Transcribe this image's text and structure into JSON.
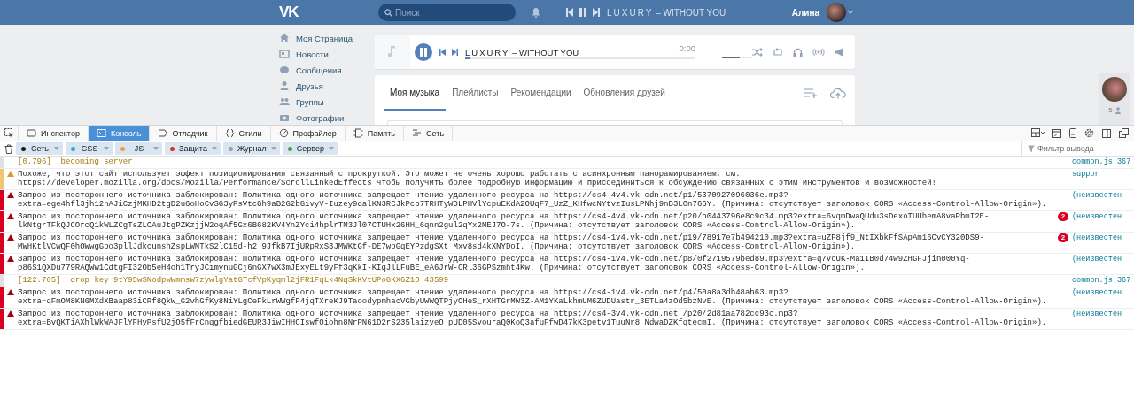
{
  "header": {
    "logo": "VK",
    "search": {
      "placeholder": "Поиск"
    },
    "now_playing": {
      "playing": true,
      "artist": "LUXURY",
      "title": "– WITHOUT YOU"
    },
    "user": {
      "name": "Алина"
    }
  },
  "sidebar": {
    "items": [
      {
        "label": "Моя Страница"
      },
      {
        "label": "Новости"
      },
      {
        "label": "Сообщения"
      },
      {
        "label": "Друзья"
      },
      {
        "label": "Группы"
      },
      {
        "label": "Фотографии"
      }
    ]
  },
  "player": {
    "playing": true,
    "artist": "LUXURY",
    "title": "– WITHOUT YOU",
    "time": "0:00",
    "progress": {
      "level": 0.02
    },
    "volume": {
      "level": 0.6
    }
  },
  "music_tabs": [
    {
      "label": "Моя музыка",
      "selected": true
    },
    {
      "label": "Плейлисты",
      "selected": false
    },
    {
      "label": "Рекомендации",
      "selected": false
    },
    {
      "label": "Обновления друзей",
      "selected": false
    }
  ],
  "friends_widget": {
    "count": "5"
  },
  "devtools": {
    "tabs": [
      {
        "label": "Инспектор",
        "selected": false
      },
      {
        "label": "Консоль",
        "selected": true
      },
      {
        "label": "Отладчик",
        "selected": false
      },
      {
        "label": "Стили",
        "selected": false
      },
      {
        "label": "Профайлер",
        "selected": false
      },
      {
        "label": "Память",
        "selected": false
      },
      {
        "label": "Сеть",
        "selected": false
      }
    ],
    "filters": [
      {
        "label": "Сеть",
        "color": "#1a1a1a",
        "on": true
      },
      {
        "label": "CSS",
        "color": "#2ea9e0",
        "on": true
      },
      {
        "label": "JS",
        "color": "#f39c32",
        "on": true
      },
      {
        "label": "Защита",
        "color": "#d32f2f",
        "on": true
      },
      {
        "label": "Журнал",
        "color": "#9e9e9e",
        "on": true
      },
      {
        "label": "Сервер",
        "color": "#4a9a4a",
        "on": true
      }
    ],
    "filter_field": {
      "placeholder": "Фильтр вывода"
    },
    "messages": [
      {
        "kind": "log",
        "text": "[0.796]  becoming server",
        "source": "common.js:367"
      },
      {
        "kind": "warning",
        "text": "Похоже, что этот сайт использует эффект позиционирования связанный с прокруткой. Это может не очень хорошо работать с асинхронным панорамированием; см. https://developer.mozilla.org/docs/Mozilla/Performance/ScrollLinkedEffects чтобы получить более подробную информацию и присоединиться к обсуждению связанных с этим инструментов и возможностей!",
        "source": "suppor"
      },
      {
        "kind": "error",
        "text": "Запрос из постороннего источника заблокирован: Политика одного источника запрещает чтение удаленного ресурса на https://cs4-4v4.vk-cdn.net/p1/5370927096036e.mp3?extra=ege4hfl3jh12nAJiCzjMKHD2tgD2u6oHoCvSG3yPsVtcGh9aB2G2bGivyV-Iuzey9qalKN3RCJkPcb7TRHTyWDLPHVlYcpuEKdA2OUqF7_UzZ_KHfwcNYtvzIusLPNhj9nB3LOn766Y. (Причина: отсутствует заголовок CORS «Access-Control-Allow-Origin»).",
        "source": "(неизвестен"
      },
      {
        "kind": "error",
        "text": "Запрос из постороннего источника заблокирован: Политика одного источника запрещает чтение удаленного ресурса на https://cs4-4v4.vk-cdn.net/p20/b0443796e8c9c34.mp3?extra=6vqmDwaQUdu3sDexoTUUhemA8vaPbmI2E-lkNtgrTFkQJCOrcQ1kWLZCgTsZLCAuJtgPZKzjjW2oqAf5Gx6B682KV4YnZYci4hplrTM3Jl07CTUHx26HH_6qnn2gul2qYx2MEJ7O-7s. (Причина: отсутствует заголовок CORS «Access-Control-Allow-Origin»).",
        "count": "2",
        "source": "(неизвестен"
      },
      {
        "kind": "error",
        "text": "Запрос из постороннего источника заблокирован: Политика одного источника запрещает чтение удаленного ресурса на https://cs4-1v4.vk-cdn.net/p19/78917e7b494210.mp3?extra=uZP8jf9_NtIXbkFfSApAm16CvCY320DS9-MWHKtlVCwQF0hOWwgGpo3pllJdkcunshZspLWNTkS2lC15d-h2_9JfkB7IjURpRxS3JMWKtGf-DE7wpGqEYPzdgSXt_Mxv8sd4kXNYDoI. (Причина: отсутствует заголовок CORS «Access-Control-Allow-Origin»).",
        "count": "2",
        "source": "(неизвестен"
      },
      {
        "kind": "error",
        "text": "Запрос из постороннего источника заблокирован: Политика одного источника запрещает чтение удаленного ресурса на https://cs4-1v4.vk-cdn.net/p8/0f2719579bed89.mp3?extra=q7VcUK-Ma1IB0d74w9ZHGFJjin000Yq-p86S1QXDu779RAQWw1CdtgFI32Ob5eH4oh1TryJCimynuGCj6nGX7wX3mJExyELt9yFf3qKkI-KIqJlLFuBE_eA6JrW-CRl36GPSzmht4Kw. (Причина: отсутствует заголовок CORS «Access-Control-Allow-Origin»).",
        "source": "(неизвестен"
      },
      {
        "kind": "log",
        "text": "[122.705]  drop key 9tY95wSNodpwWmmsW7zywlgYatGTcfVpKyqml2jFR1FqLk4NqSkKVtUPoGKX6Z1O 43599",
        "source": "common.js:367"
      },
      {
        "kind": "error",
        "text": "Запрос из постороннего источника заблокирован: Политика одного источника запрещает чтение удаленного ресурса на https://cs4-1v4.vk-cdn.net/p4/50a8a3db48ab63.mp3?extra=qFmOM8KN6MXdXBaap83iCRf8QkW_G2vhGfKy8NiYLgCeFkLrWWgfP4jqTXreKJ9TaoodypmhacVGbyUWWQTPjyOHeS_rXHTGrMW3Z-AM1YKaLkhmUM6ZUDUastr_3ETLa4zOd5bzNvE. (Причина: отсутствует заголовок CORS «Access-Control-Allow-Origin»).",
        "source": "(неизвестен"
      },
      {
        "kind": "error",
        "text": "Запрос из постороннего источника заблокирован: Политика одного источника запрещает чтение удаленного ресурса на https://cs4-3v4.vk-cdn.net /p20/2d81aa782cc93c.mp3?extra=BvQKTiAXhlWkWAJFlYFHyPsfU2jO5fFrCnqgfbiedGEUR3JiwIHHCIswfOiohn8NrPN61D2rS235laizyeO_pUD05SvouraQ0KoQ3afuFfwD47kK3petv1TuuNr8_NdwaDZKfqtecmI. (Причина: отсутствует заголовок CORS «Access-Control-Allow-Origin»).",
        "source": "(неизвестен"
      }
    ]
  }
}
